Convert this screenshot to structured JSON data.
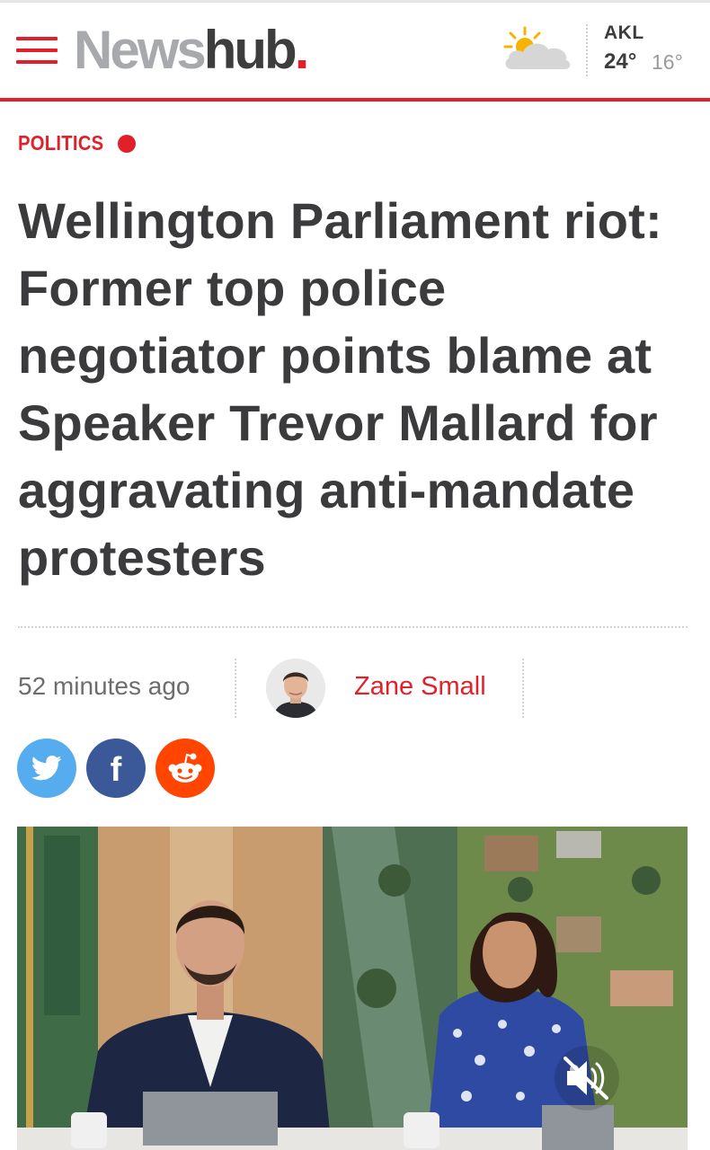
{
  "header": {
    "logo_news": "News",
    "logo_hub": "hub",
    "logo_dot": ".",
    "weather": {
      "city": "AKL",
      "high": "24°",
      "low": "16°",
      "icon": "partly-cloudy-icon"
    }
  },
  "article": {
    "category": "POLITICS",
    "headline": "Wellington Parliament riot: Former top police negotiator points blame at Speaker Trevor Mallard for aggravating anti-mandate protesters",
    "time_ago": "52 minutes ago",
    "author": "Zane Small"
  },
  "share": {
    "buttons": [
      {
        "name": "twitter",
        "icon": "twitter-icon",
        "color": "#55acee"
      },
      {
        "name": "facebook",
        "icon": "facebook-icon",
        "color": "#3b5998"
      },
      {
        "name": "reddit",
        "icon": "reddit-icon",
        "color": "#ff4500"
      }
    ]
  },
  "video": {
    "mute_icon": "muted-speaker-icon"
  },
  "colors": {
    "brand_red": "#e2202a",
    "text_dark": "#3b3b3d",
    "text_gray": "#6d6d6d"
  }
}
